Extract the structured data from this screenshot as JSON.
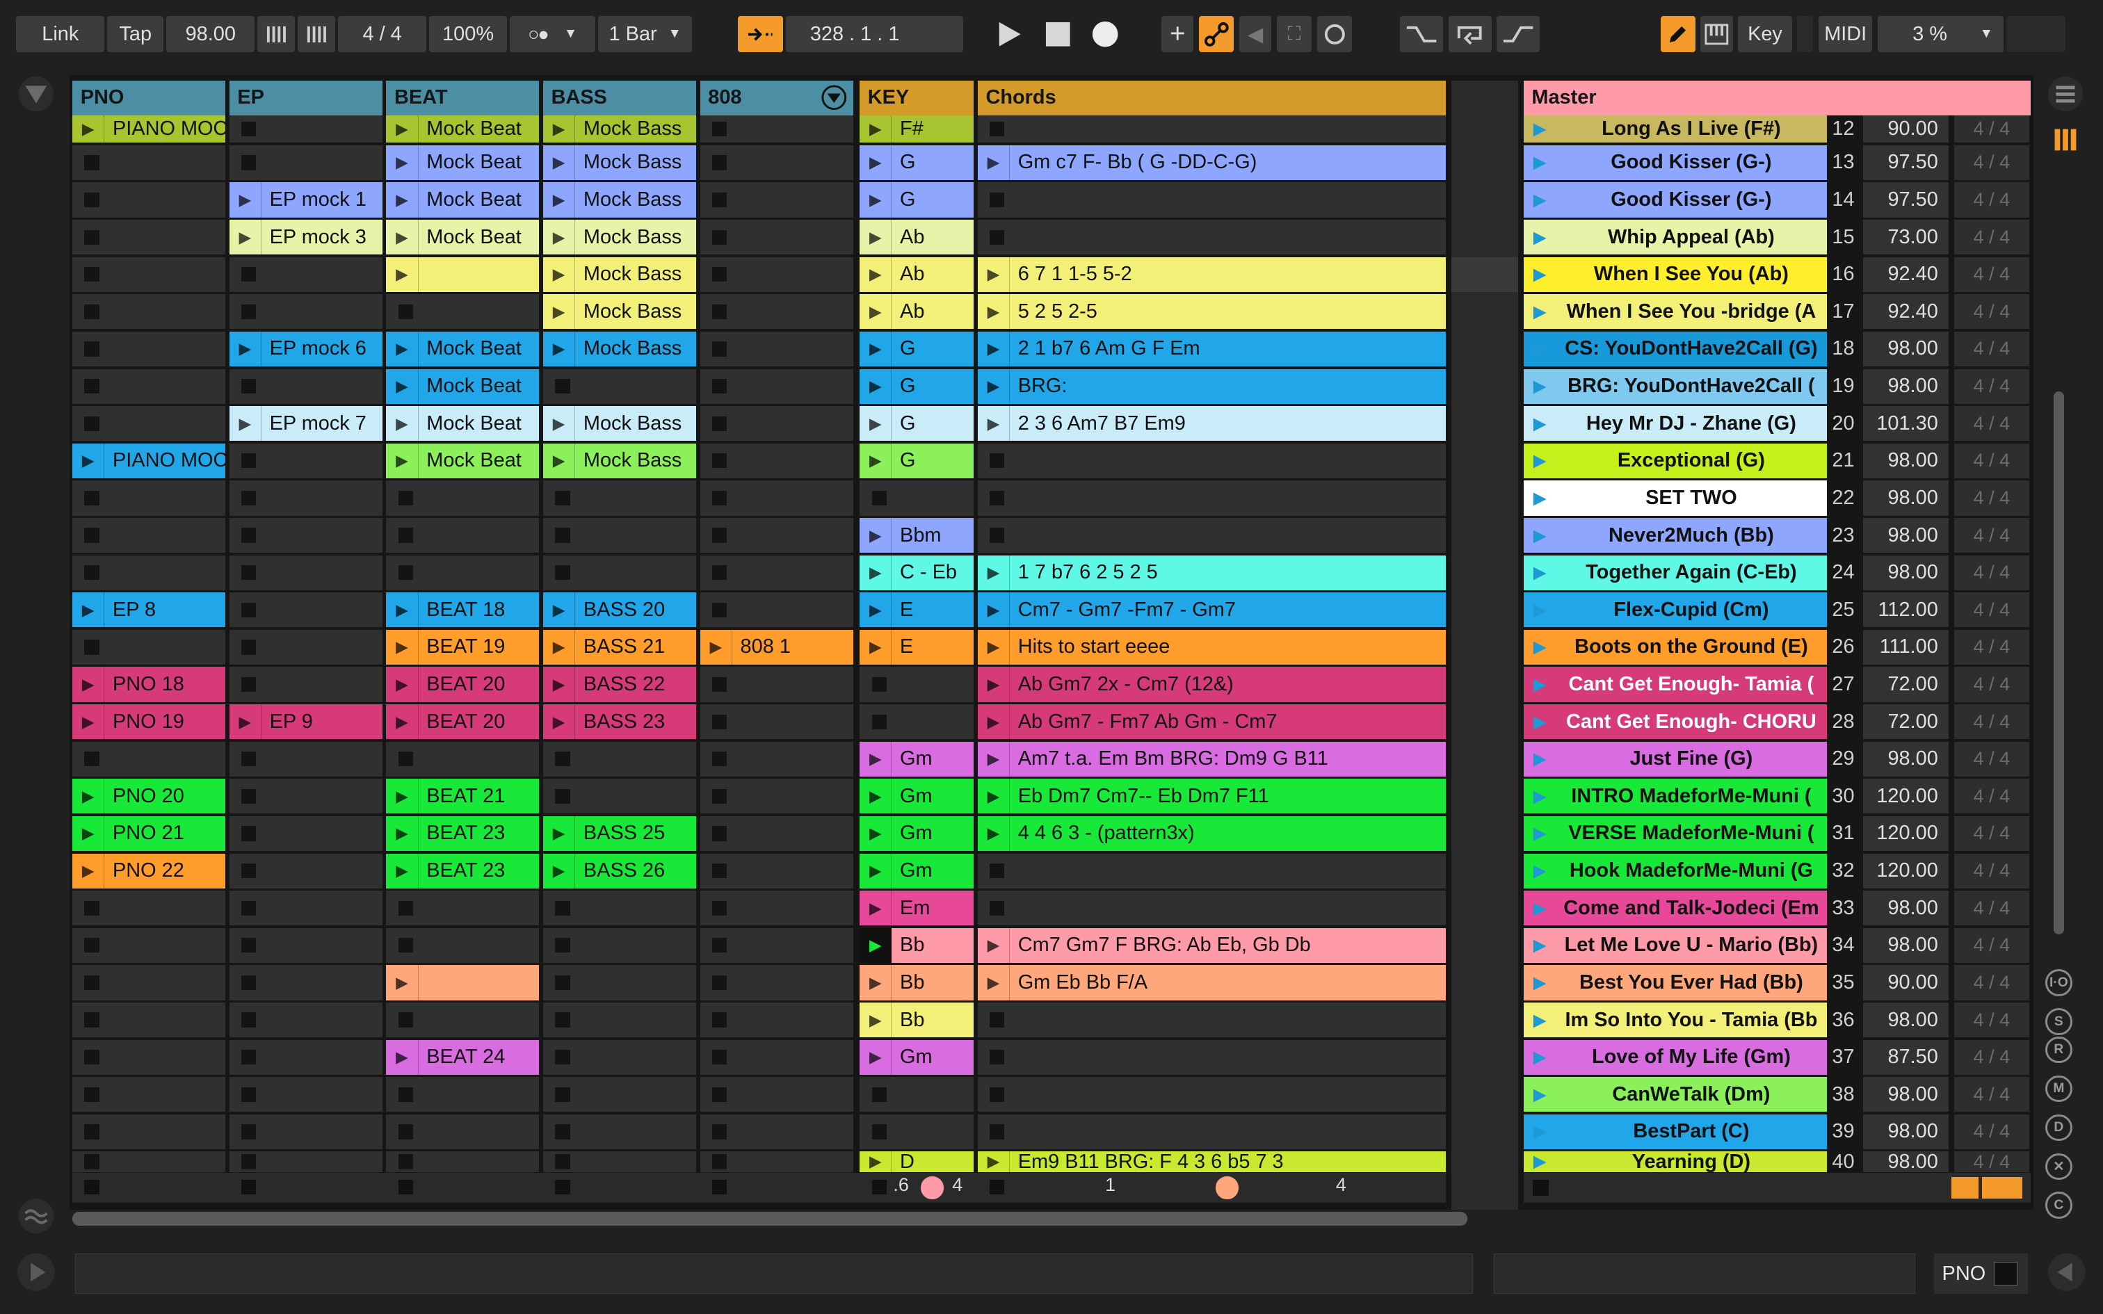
{
  "transport": {
    "link": "Link",
    "tap": "Tap",
    "tempo": "98.00",
    "time_signature": "4 / 4",
    "zoom": "100%",
    "quantize": "1 Bar",
    "position": "328 .   1 .   1",
    "key_label": "Key",
    "midi_label": "MIDI",
    "cpu": "3 %"
  },
  "tracks": [
    {
      "name": "PNO",
      "color": "#4c8fa4"
    },
    {
      "name": "EP",
      "color": "#4c8fa4"
    },
    {
      "name": "BEAT",
      "color": "#4c8fa4"
    },
    {
      "name": "BASS",
      "color": "#4c8fa4"
    },
    {
      "name": "808",
      "color": "#4c8fa4"
    },
    {
      "name": "KEY",
      "color": "#d49b2a"
    },
    {
      "name": "Chords",
      "color": "#d49b2a"
    }
  ],
  "master": {
    "name": "Master",
    "color": "#ff9aa8"
  },
  "clips": {
    "pno": [
      {
        "row": 0,
        "name": "PIANO MOC",
        "color": "#a9c431"
      },
      {
        "row": 9,
        "name": "PIANO MOC",
        "color": "#20a6e9"
      },
      {
        "row": 13,
        "name": "EP 8",
        "color": "#20a6e9"
      },
      {
        "row": 15,
        "name": "PNO 18",
        "color": "#d73a79"
      },
      {
        "row": 16,
        "name": "PNO 19",
        "color": "#d73a79"
      },
      {
        "row": 18,
        "name": "PNO 20",
        "color": "#18e838"
      },
      {
        "row": 19,
        "name": "PNO 21",
        "color": "#18e838"
      },
      {
        "row": 20,
        "name": "PNO 22",
        "color": "#ff9d2c"
      }
    ],
    "ep": [
      {
        "row": 2,
        "name": "EP mock 1",
        "color": "#8fa6ff"
      },
      {
        "row": 3,
        "name": "EP mock 3",
        "color": "#e8f3aa"
      },
      {
        "row": 6,
        "name": "EP mock 6",
        "color": "#20a6e9"
      },
      {
        "row": 8,
        "name": "EP mock 7",
        "color": "#c9ecf8"
      },
      {
        "row": 16,
        "name": "EP 9",
        "color": "#d73a79"
      }
    ],
    "beat": [
      {
        "row": 0,
        "name": "Mock Beat",
        "color": "#a9c431"
      },
      {
        "row": 1,
        "name": "Mock Beat",
        "color": "#8fa6ff"
      },
      {
        "row": 2,
        "name": "Mock Beat",
        "color": "#8fa6ff"
      },
      {
        "row": 3,
        "name": "Mock Beat",
        "color": "#e8f3aa"
      },
      {
        "row": 4,
        "name": "",
        "color": "#f3f07a"
      },
      {
        "row": 6,
        "name": "Mock Beat",
        "color": "#20a6e9"
      },
      {
        "row": 7,
        "name": "Mock Beat",
        "color": "#20a6e9"
      },
      {
        "row": 8,
        "name": "Mock Beat",
        "color": "#c9ecf8"
      },
      {
        "row": 9,
        "name": "Mock Beat",
        "color": "#8cf05a"
      },
      {
        "row": 13,
        "name": "BEAT 18",
        "color": "#20a6e9"
      },
      {
        "row": 14,
        "name": "BEAT 19",
        "color": "#ff9d2c"
      },
      {
        "row": 15,
        "name": "BEAT 20",
        "color": "#d73a79"
      },
      {
        "row": 16,
        "name": "BEAT 20",
        "color": "#d73a79"
      },
      {
        "row": 18,
        "name": "BEAT 21",
        "color": "#18e838"
      },
      {
        "row": 19,
        "name": "BEAT 23",
        "color": "#18e838"
      },
      {
        "row": 20,
        "name": "BEAT 23",
        "color": "#18e838"
      },
      {
        "row": 23,
        "name": "",
        "color": "#ffa77c"
      },
      {
        "row": 25,
        "name": "BEAT 24",
        "color": "#d86ce0"
      }
    ],
    "bass": [
      {
        "row": 0,
        "name": "Mock Bass",
        "color": "#a9c431"
      },
      {
        "row": 1,
        "name": "Mock Bass",
        "color": "#8fa6ff"
      },
      {
        "row": 2,
        "name": "Mock Bass",
        "color": "#8fa6ff"
      },
      {
        "row": 3,
        "name": "Mock Bass",
        "color": "#e8f3aa"
      },
      {
        "row": 4,
        "name": "Mock Bass",
        "color": "#f3f07a"
      },
      {
        "row": 5,
        "name": "Mock Bass",
        "color": "#f3f07a"
      },
      {
        "row": 6,
        "name": "Mock Bass",
        "color": "#20a6e9"
      },
      {
        "row": 8,
        "name": "Mock Bass",
        "color": "#c9ecf8"
      },
      {
        "row": 9,
        "name": "Mock Bass",
        "color": "#8cf05a"
      },
      {
        "row": 13,
        "name": "BASS 20",
        "color": "#20a6e9"
      },
      {
        "row": 14,
        "name": "BASS 21",
        "color": "#ff9d2c"
      },
      {
        "row": 15,
        "name": "BASS 22",
        "color": "#d73a79"
      },
      {
        "row": 16,
        "name": "BASS 23",
        "color": "#d73a79"
      },
      {
        "row": 19,
        "name": "BASS 25",
        "color": "#18e838"
      },
      {
        "row": 20,
        "name": "BASS 26",
        "color": "#18e838"
      }
    ],
    "s808": [
      {
        "row": 14,
        "name": "808 1",
        "color": "#ff9d2c"
      }
    ],
    "key": [
      {
        "row": 0,
        "name": "F#",
        "color": "#a9c431"
      },
      {
        "row": 1,
        "name": "G",
        "color": "#8fa6ff"
      },
      {
        "row": 2,
        "name": "G",
        "color": "#8fa6ff"
      },
      {
        "row": 3,
        "name": "Ab",
        "color": "#e8f3aa"
      },
      {
        "row": 4,
        "name": "Ab",
        "color": "#f3f07a"
      },
      {
        "row": 5,
        "name": "Ab",
        "color": "#f3f07a"
      },
      {
        "row": 6,
        "name": "G",
        "color": "#20a6e9"
      },
      {
        "row": 7,
        "name": "G",
        "color": "#20a6e9"
      },
      {
        "row": 8,
        "name": "G",
        "color": "#c9ecf8"
      },
      {
        "row": 9,
        "name": "G",
        "color": "#8cf05a"
      },
      {
        "row": 11,
        "name": "Bbm",
        "color": "#8fa6ff"
      },
      {
        "row": 12,
        "name": "C - Eb",
        "color": "#5ff7e6"
      },
      {
        "row": 13,
        "name": "E",
        "color": "#20a6e9"
      },
      {
        "row": 14,
        "name": "E",
        "color": "#ff9d2c"
      },
      {
        "row": 17,
        "name": "Gm",
        "color": "#d86ce0"
      },
      {
        "row": 18,
        "name": "Gm",
        "color": "#18e838"
      },
      {
        "row": 19,
        "name": "Gm",
        "color": "#18e838"
      },
      {
        "row": 20,
        "name": "Gm",
        "color": "#18e838"
      },
      {
        "row": 21,
        "name": "Em",
        "color": "#e8489a"
      },
      {
        "row": 22,
        "name": "Bb",
        "color": "#ff9aa8",
        "playing": true
      },
      {
        "row": 23,
        "name": "Bb",
        "color": "#ffa77c"
      },
      {
        "row": 24,
        "name": "Bb",
        "color": "#f3f07a"
      },
      {
        "row": 25,
        "name": "Gm",
        "color": "#d86ce0"
      },
      {
        "row": 28,
        "name": "D",
        "color": "#c9e830"
      }
    ],
    "chords": [
      {
        "row": 1,
        "name": "Gm  c7 F- Bb ( G -DD-C-G)",
        "color": "#8fa6ff"
      },
      {
        "row": 4,
        "name": "6 7  1  1-5  5-2",
        "color": "#f3f07a"
      },
      {
        "row": 5,
        "name": "5  2  5    2-5",
        "color": "#f3f07a"
      },
      {
        "row": 6,
        "name": "2 1 b7 6  Am G  F Em",
        "color": "#20a6e9"
      },
      {
        "row": 7,
        "name": "BRG:",
        "color": "#20a6e9"
      },
      {
        "row": 8,
        "name": "2  3  6  Am7  B7  Em9",
        "color": "#c9ecf8"
      },
      {
        "row": 12,
        "name": "1  7  b7  6  2  5   2 5",
        "color": "#5ff7e6"
      },
      {
        "row": 13,
        "name": "Cm7 - Gm7 -Fm7     - Gm7",
        "color": "#20a6e9"
      },
      {
        "row": 14,
        "name": "Hits to start eeee",
        "color": "#ff9d2c"
      },
      {
        "row": 15,
        "name": "Ab Gm7   2x     - Cm7 (12&)",
        "color": "#d73a79"
      },
      {
        "row": 16,
        "name": "Ab Gm7 - Fm7      Ab  Gm - Cm7",
        "color": "#d73a79"
      },
      {
        "row": 17,
        "name": "Am7   t.a. Em Bm  BRG: Dm9 G B11",
        "color": "#d86ce0"
      },
      {
        "row": 18,
        "name": "Eb Dm7 Cm7--  Eb  Dm7 F11",
        "color": "#18e838"
      },
      {
        "row": 19,
        "name": "4  4 6  3 - (pattern3x)",
        "color": "#18e838"
      },
      {
        "row": 22,
        "name": "Cm7 Gm7 F  BRG: Ab Eb, Gb Db",
        "color": "#ff9aa8"
      },
      {
        "row": 23,
        "name": "Gm Eb Bb F/A",
        "color": "#ffa77c"
      },
      {
        "row": 28,
        "name": "Em9  B11  BRG: F 4  3 6   b5 7 3",
        "color": "#c9e830"
      }
    ]
  },
  "scenes": [
    {
      "name": "Long As I Live (F#)",
      "color": "#c8b860",
      "num": "12",
      "bpm": "90.00",
      "sig": "4 / 4"
    },
    {
      "name": "Good Kisser (G-)",
      "color": "#8fa6ff",
      "num": "13",
      "bpm": "97.50",
      "sig": "4 / 4"
    },
    {
      "name": "Good Kisser (G-)",
      "color": "#8fa6ff",
      "num": "14",
      "bpm": "97.50",
      "sig": "4 / 4"
    },
    {
      "name": "Whip Appeal (Ab)",
      "color": "#e8f3aa",
      "num": "15",
      "bpm": "73.00",
      "sig": "4 / 4"
    },
    {
      "name": "When I See You (Ab)",
      "color": "#ffee2c",
      "num": "16",
      "bpm": "92.40",
      "sig": "4 / 4"
    },
    {
      "name": "When I See You -bridge (A",
      "color": "#f3f07a",
      "num": "17",
      "bpm": "92.40",
      "sig": "4 / 4"
    },
    {
      "name": "CS: YouDontHave2Call (G)",
      "color": "#1899da",
      "num": "18",
      "bpm": "98.00",
      "sig": "4 / 4"
    },
    {
      "name": "BRG: YouDontHave2Call (",
      "color": "#7fc8f0",
      "num": "19",
      "bpm": "98.00",
      "sig": "4 / 4"
    },
    {
      "name": "Hey Mr DJ - Zhane (G)",
      "color": "#c9ecf8",
      "num": "20",
      "bpm": "101.30",
      "sig": "4 / 4"
    },
    {
      "name": "Exceptional (G)",
      "color": "#c4f01c",
      "num": "21",
      "bpm": "98.00",
      "sig": "4 / 4"
    },
    {
      "name": "SET TWO",
      "color": "#ffffff",
      "num": "22",
      "bpm": "98.00",
      "sig": "4 / 4"
    },
    {
      "name": "Never2Much (Bb)",
      "color": "#8fa6ff",
      "num": "23",
      "bpm": "98.00",
      "sig": "4 / 4"
    },
    {
      "name": "Together Again (C-Eb)",
      "color": "#5ff7e6",
      "num": "24",
      "bpm": "98.00",
      "sig": "4 / 4"
    },
    {
      "name": "Flex-Cupid (Cm)",
      "color": "#20a6e9",
      "num": "25",
      "bpm": "112.00",
      "sig": "4 / 4"
    },
    {
      "name": "Boots on the Ground (E)",
      "color": "#ff9d2c",
      "num": "26",
      "bpm": "111.00",
      "sig": "4 / 4"
    },
    {
      "name": "Cant Get Enough- Tamia (",
      "color": "#d73a79",
      "num": "27",
      "bpm": "72.00",
      "sig": "4 / 4",
      "light": true
    },
    {
      "name": "Cant Get Enough- CHORU",
      "color": "#d73a79",
      "num": "28",
      "bpm": "72.00",
      "sig": "4 / 4",
      "light": true
    },
    {
      "name": "Just Fine (G)",
      "color": "#d86ce0",
      "num": "29",
      "bpm": "98.00",
      "sig": "4 / 4"
    },
    {
      "name": "INTRO MadeforMe-Muni (",
      "color": "#18e838",
      "num": "30",
      "bpm": "120.00",
      "sig": "4 / 4"
    },
    {
      "name": "VERSE MadeforMe-Muni (",
      "color": "#18e838",
      "num": "31",
      "bpm": "120.00",
      "sig": "4 / 4"
    },
    {
      "name": "Hook MadeforMe-Muni (G",
      "color": "#18e838",
      "num": "32",
      "bpm": "120.00",
      "sig": "4 / 4"
    },
    {
      "name": "Come and Talk-Jodeci (Em",
      "color": "#e8489a",
      "num": "33",
      "bpm": "98.00",
      "sig": "4 / 4"
    },
    {
      "name": "Let Me Love U - Mario (Bb)",
      "color": "#ff9aa8",
      "num": "34",
      "bpm": "98.00",
      "sig": "4 / 4"
    },
    {
      "name": "Best You Ever Had (Bb)",
      "color": "#ffa77c",
      "num": "35",
      "bpm": "90.00",
      "sig": "4 / 4"
    },
    {
      "name": "Im So Into You - Tamia (Bb",
      "color": "#f3f07a",
      "num": "36",
      "bpm": "98.00",
      "sig": "4 / 4"
    },
    {
      "name": "Love of My Life (Gm)",
      "color": "#d86ce0",
      "num": "37",
      "bpm": "87.50",
      "sig": "4 / 4"
    },
    {
      "name": "CanWeTalk (Dm)",
      "color": "#8cf05a",
      "num": "38",
      "bpm": "98.00",
      "sig": "4 / 4"
    },
    {
      "name": "BestPart (C)",
      "color": "#20a6e9",
      "num": "39",
      "bpm": "98.00",
      "sig": "4 / 4"
    },
    {
      "name": "Yearning (D)",
      "color": "#c9e830",
      "num": "40",
      "bpm": "98.00",
      "sig": "4 / 4"
    }
  ],
  "footer": {
    "key_volume": ".6",
    "key_pan": "4",
    "chords_volume": "1",
    "chords_pan": "4"
  },
  "status": {
    "track_name": "PNO"
  }
}
